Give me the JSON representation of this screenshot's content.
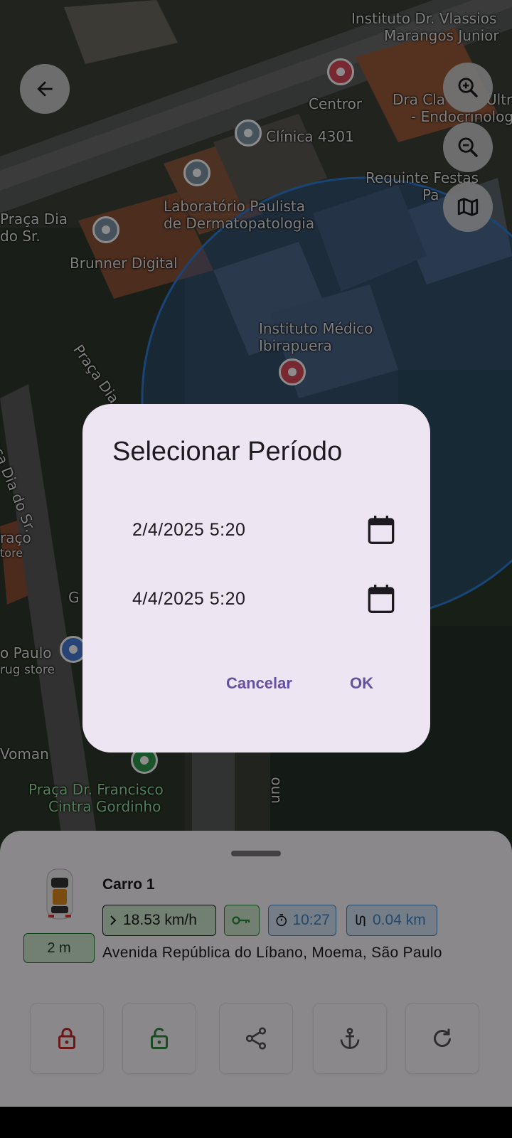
{
  "map": {
    "labels": [
      {
        "text": "Instituto Dr. Vlassios"
      },
      {
        "text": "Marangos Junior"
      },
      {
        "text": "Centror"
      },
      {
        "text": "Dra Cla"
      },
      {
        "text": "Ultr"
      },
      {
        "text": "- Endocrinologi"
      },
      {
        "text": "Clínica 4301"
      },
      {
        "text": "Requinte Festas"
      },
      {
        "text": "Pa"
      },
      {
        "text": "Laboratório Paulista"
      },
      {
        "text": "de Dermatopatologia"
      },
      {
        "text": "Praça Dia"
      },
      {
        "text": "do Sr."
      },
      {
        "text": "Brunner Digital"
      },
      {
        "text": "Instituto Médico"
      },
      {
        "text": "Ibirapuera"
      },
      {
        "text": "Praça Dia do"
      },
      {
        "text": "Praça Dia do Sr."
      },
      {
        "text": "raço"
      },
      {
        "text": "tore"
      },
      {
        "text": "G"
      },
      {
        "text": "o Paulo"
      },
      {
        "text": "rug store"
      },
      {
        "text": "Voman"
      },
      {
        "text": "Praça Dr. Francisco"
      },
      {
        "text": "Cintra Gordinho"
      },
      {
        "text": "uno"
      }
    ],
    "back_icon": "arrow-left-icon",
    "zoom_in_icon": "zoom-in-icon",
    "zoom_out_icon": "zoom-out-icon",
    "layers_icon": "map-icon"
  },
  "dialog": {
    "title": "Selecionar Período",
    "start_date": "2/4/2025 5:20",
    "end_date": "4/4/2025 5:20",
    "cancel_label": "Cancelar",
    "ok_label": "OK",
    "accent_color": "#6750a4"
  },
  "vehicle": {
    "name": "Carro 1",
    "distance_badge": "2 m",
    "speed": "18.53 km/h",
    "duration": "10:27",
    "trip_distance": "0.04 km",
    "address": "Avenida República do Líbano, Moema, São Paulo",
    "actions": [
      {
        "icon": "lock-icon",
        "color": "#c62828"
      },
      {
        "icon": "unlock-icon",
        "color": "#2e8b3b"
      },
      {
        "icon": "share-icon",
        "color": "#555555"
      },
      {
        "icon": "anchor-icon",
        "color": "#555555"
      },
      {
        "icon": "refresh-icon",
        "color": "#555555"
      }
    ]
  }
}
